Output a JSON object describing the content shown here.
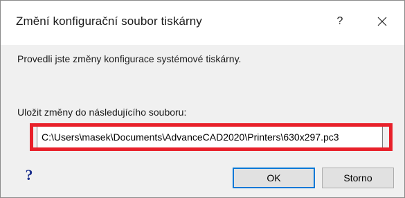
{
  "dialog": {
    "title": "Změní konfigurační soubor tiskárny",
    "help_glyph": "?",
    "close_icon": "close-icon"
  },
  "content": {
    "message": "Provedli jste změny konfigurace systémové tiskárny.",
    "save_label": "Uložit změny do následujícího souboru:",
    "path_value": "C:\\Users\\masek\\Documents\\AdvanceCAD2020\\Printers\\630x297.pc3"
  },
  "footer": {
    "help_glyph": "?",
    "ok_label": "OK",
    "cancel_label": "Storno"
  },
  "colors": {
    "highlight": "#e8202a",
    "focus_border": "#0078d7",
    "help_icon": "#1a2e8c"
  }
}
